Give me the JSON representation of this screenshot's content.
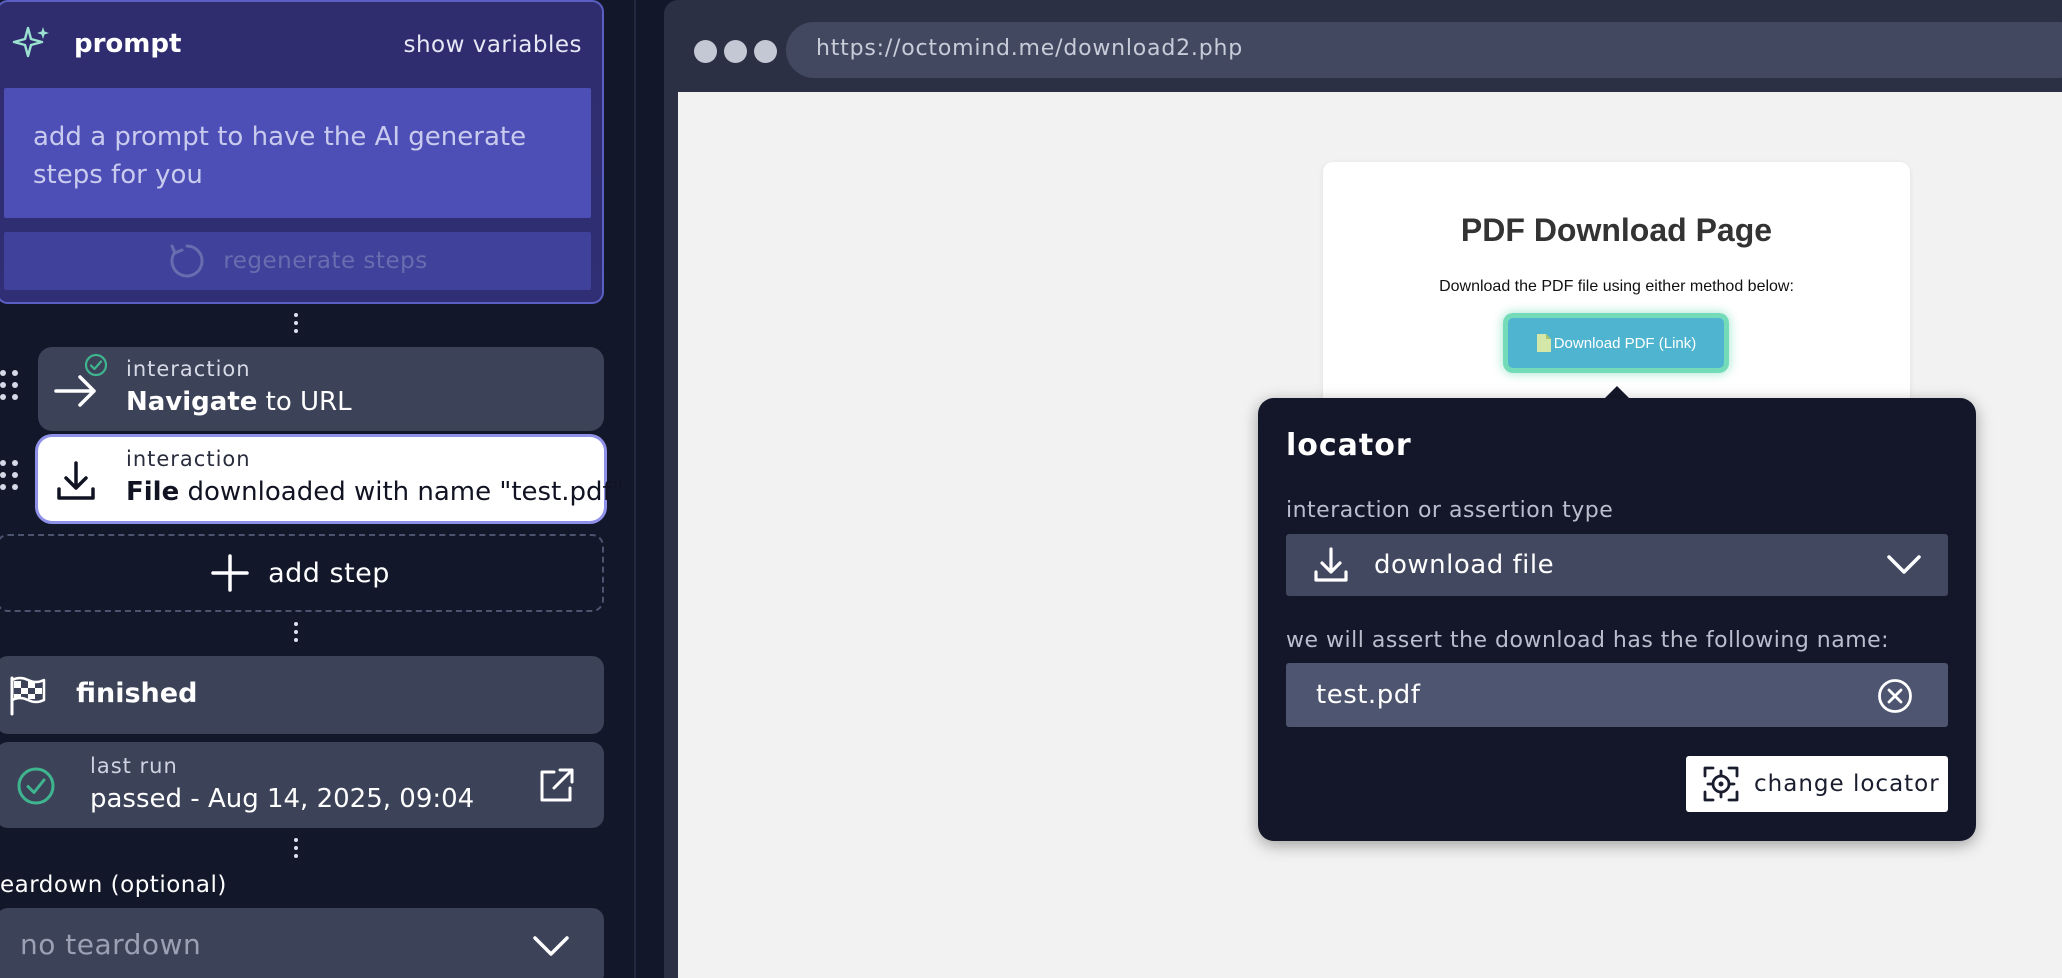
{
  "prompt": {
    "title": "prompt",
    "show_variables": "show variables",
    "placeholder": "add a prompt to have the AI generate steps for you",
    "regenerate": "regenerate steps"
  },
  "steps": [
    {
      "kind": "interaction",
      "bold": "Navigate",
      "text": " to URL",
      "icon": "arrow-right-icon",
      "status": "passed"
    },
    {
      "kind": "interaction",
      "bold": "File",
      "text": " downloaded with name \"test.pdf\"",
      "icon": "download-icon",
      "selected": true
    }
  ],
  "add_step": "add step",
  "finished": "finished",
  "last_run": {
    "label": "last run",
    "value": "passed - Aug 14, 2025, 09:04"
  },
  "teardown": {
    "label": "eardown (optional)",
    "value": "no teardown"
  },
  "browser": {
    "url": "https://octomind.me/download2.php"
  },
  "page": {
    "title": "PDF Download Page",
    "subtitle": "Download the PDF file using either method below:",
    "button": "Download PDF (Link)"
  },
  "locator": {
    "title": "locator",
    "type_label": "interaction or assertion type",
    "type_value": "download file",
    "name_label": "we will assert the download has the following name:",
    "name_value": "test.pdf",
    "change_button": "change locator"
  },
  "colors": {
    "accent": "#4d4fb6",
    "success": "#3fb58f",
    "highlight": "#73dbb8",
    "page_button": "#4eb4cf"
  }
}
